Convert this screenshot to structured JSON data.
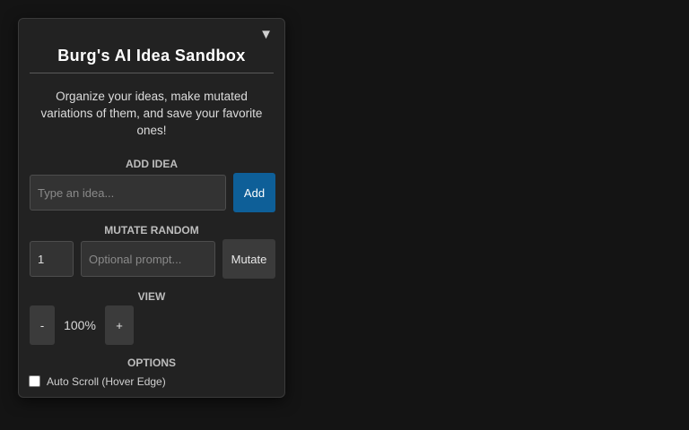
{
  "panel": {
    "collapse_icon": "▼",
    "title": "Burg's AI Idea Sandbox",
    "description": "Organize your ideas, make mutated variations of them, and save your favorite ones!"
  },
  "add_idea": {
    "label": "ADD IDEA",
    "input_placeholder": "Type an idea...",
    "input_value": "",
    "button_label": "Add"
  },
  "mutate_random": {
    "label": "MUTATE RANDOM",
    "count_value": "1",
    "prompt_placeholder": "Optional prompt...",
    "prompt_value": "",
    "button_label": "Mutate"
  },
  "view": {
    "label": "VIEW",
    "zoom_out_label": "-",
    "zoom_value": "100%",
    "zoom_in_label": "+"
  },
  "options": {
    "label": "OPTIONS",
    "auto_scroll_label": "Auto Scroll (Hover Edge)",
    "auto_scroll_checked": false
  },
  "colors": {
    "background": "#141414",
    "panel": "#222222",
    "primary_button": "#0e5f98",
    "secondary_button": "#3b3b3b"
  }
}
